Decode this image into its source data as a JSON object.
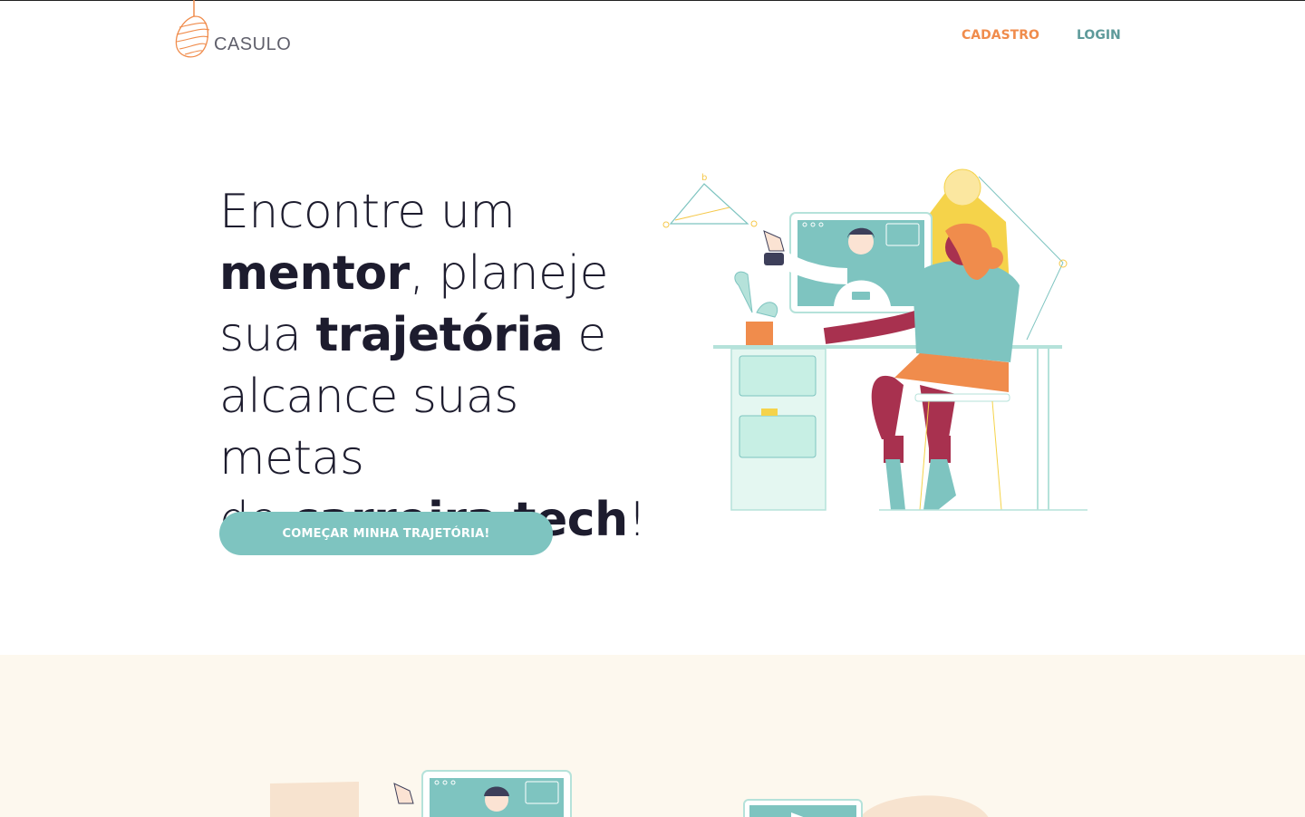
{
  "brand": {
    "name": "CASULO",
    "logo_icon": "cocoon-icon",
    "accent": "#f08c4c"
  },
  "nav": {
    "cadastro": "CADASTRO",
    "login": "LOGIN",
    "cadastro_color": "#f08c4c",
    "login_color": "#5e9a9a"
  },
  "hero": {
    "title_parts": {
      "p1": "Encontre um",
      "p2": "mentor",
      "p3": ", planeje",
      "p4": "sua",
      "p5": "trajetória",
      "p6": " e",
      "p7": "alcance suas metas",
      "p8": "de",
      "p9": "carreira tech",
      "p10": "!"
    },
    "cta_label": "COMEÇAR MINHA TRAJETÓRIA!",
    "cta_color": "#7ec4c0",
    "illustration": "mentoring-video-call-illustration"
  },
  "section2": {
    "background": "#fdf8ee",
    "illustrations": [
      "video-call-illustration",
      "laptop-illustration"
    ]
  }
}
